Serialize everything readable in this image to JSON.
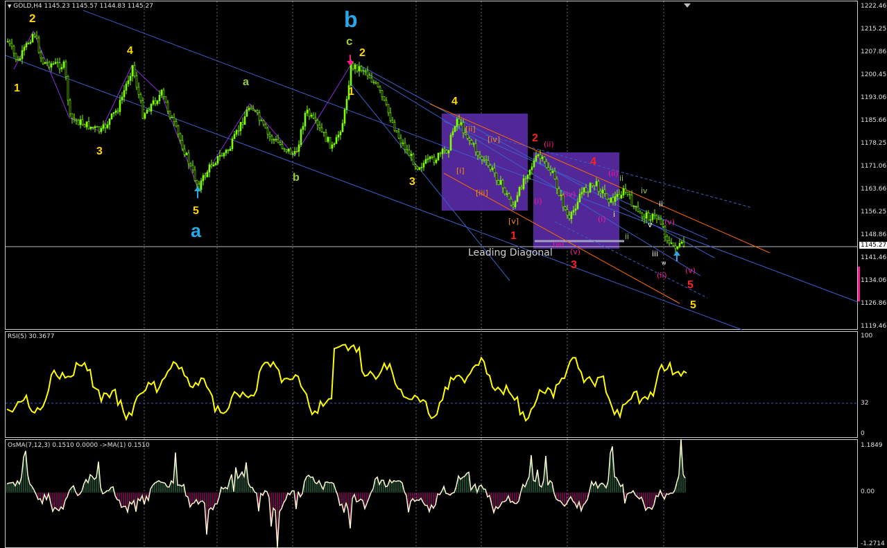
{
  "chart_header": {
    "symbol_menu_icon": "triangle-down-icon",
    "label": "GOLD,H4  1145.23 1145.57 1144.83 1145.27"
  },
  "price_axis": {
    "ticks": [
      "1222.46",
      "1215.25",
      "1207.86",
      "1200.45",
      "1193.06",
      "1185.66",
      "1178.25",
      "1171.06",
      "1163.66",
      "1156.25",
      "1148.86",
      "1141.46",
      "1134.06",
      "1126.86",
      "1119.46"
    ],
    "current_price": "1145.27"
  },
  "rsi_panel": {
    "label": "RSI(5) 30.3677",
    "ticks": [
      "100",
      "32",
      "0"
    ]
  },
  "osma_panel": {
    "label": "OsMA(7,12,3) 0.1510 0.0000  ->MA(1) 0.1510",
    "ticks": [
      "1.1849",
      "0.00",
      "-1.2714"
    ]
  },
  "wave_labels": {
    "w1": "1",
    "w2": "2",
    "w3": "3",
    "w4": "4",
    "w5": "5",
    "wa": "a",
    "sa": "a",
    "sb": "b",
    "bigb": "b",
    "sc": "c",
    "n1": "1",
    "n2": "2",
    "n3": "3",
    "n4": "4",
    "n5": "5",
    "r1": "1",
    "r2": "2",
    "r3": "3",
    "r4": "4",
    "r5": "5",
    "lastfive": "5"
  },
  "sub_labels": {
    "i1": "[i]",
    "i2": "[ii]",
    "i3": "[iii]",
    "i4": "[iv]",
    "i5": "[v]",
    "m1": "(i)",
    "m2": "(ii)",
    "m3": "(iii)",
    "m4": "(iv)",
    "m5": "(v)",
    "mm1": "(i)",
    "mm2": "(ii)",
    "mm5": "(v)",
    "mm2b": "(ii)",
    "mm5b": "(v)",
    "s_i": "i",
    "s_ii": "ii",
    "s_iii": "iii",
    "s_iv": "iv",
    "s_v": "v",
    "s_ii2": "ii",
    "s_iii2": "iii",
    "s_ii3": "ii",
    "s_w": "w"
  },
  "annotation_text": "Leading Diagonal",
  "colors": {
    "candles": "#7fff00",
    "wave_yellow": "#ffd700",
    "wave_blue": "#2aa7e8",
    "wave_red": "#ff2020",
    "wave_green": "#9acd32",
    "channel_blue": "#3a5fcd",
    "channel_orange": "#ff6a00",
    "box_purple": "#5b2ca8",
    "rsi_line": "#ffff00",
    "osma_line": "#fffacd",
    "magenta": "#ff1493"
  }
}
